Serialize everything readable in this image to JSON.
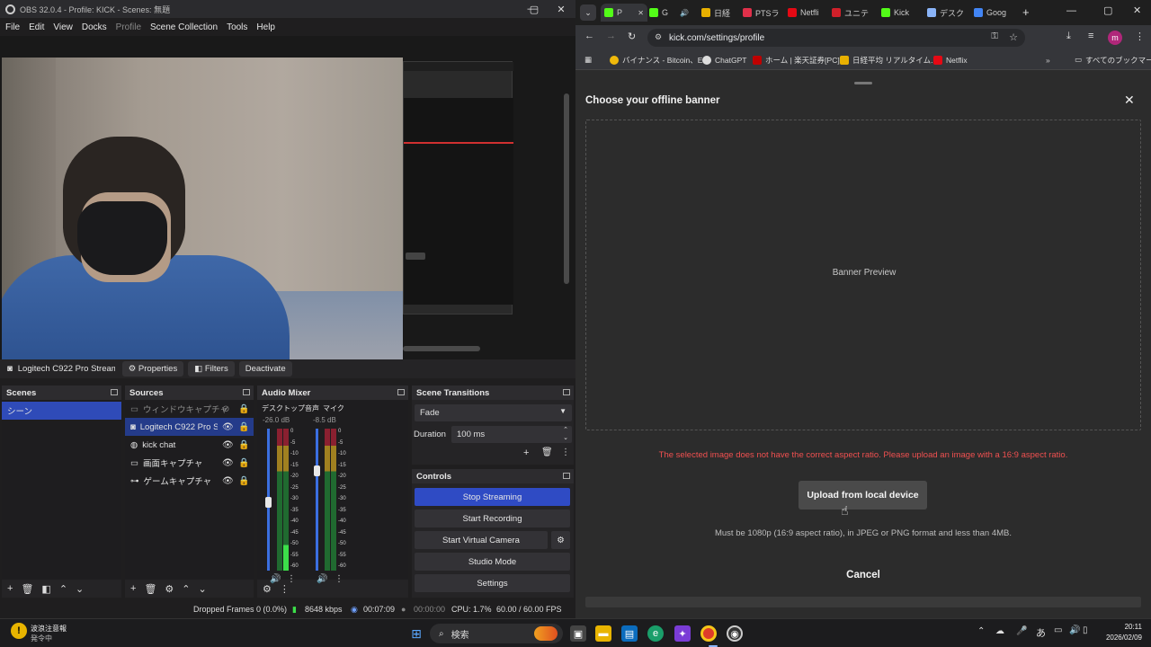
{
  "obs": {
    "title": "OBS 32.0.4 - Profile: KICK - Scenes: 無題",
    "menu": [
      "File",
      "Edit",
      "View",
      "Docks",
      "Profile",
      "Scene Collection",
      "Tools",
      "Help"
    ],
    "source_toolbar": {
      "source_name": "Logitech C922 Pro Stream W",
      "properties": "Properties",
      "filters": "Filters",
      "deactivate": "Deactivate"
    },
    "docks": {
      "scenes": {
        "title": "Scenes",
        "items": [
          "シーン"
        ]
      },
      "sources": {
        "title": "Sources",
        "items": [
          "ウィンドウキャプチャ",
          "Logitech C922 Pro Stre",
          "kick chat",
          "画面キャプチャ",
          "ゲームキャプチャ"
        ]
      },
      "audio_mixer": {
        "title": "Audio Mixer",
        "channels": [
          {
            "name": "デスクトップ音声",
            "db": "-26.0 dB"
          },
          {
            "name": "マイク",
            "db": "-8.5 dB"
          }
        ],
        "scale": [
          "0",
          "-5",
          "-10",
          "-15",
          "-20",
          "-25",
          "-30",
          "-35",
          "-40",
          "-45",
          "-50",
          "-55",
          "-60"
        ]
      },
      "scene_transitions": {
        "title": "Scene Transitions",
        "transition": "Fade",
        "duration_label": "Duration",
        "duration_value": "100 ms"
      },
      "controls": {
        "title": "Controls",
        "buttons": [
          "Stop Streaming",
          "Start Recording",
          "Start Virtual Camera",
          "Studio Mode",
          "Settings"
        ]
      }
    },
    "status": {
      "dropped_frames": "Dropped Frames 0 (0.0%)",
      "bitrate": "8648 kbps",
      "stream_time": "00:07:09",
      "rec_time": "00:00:00",
      "cpu": "CPU: 1.7%",
      "fps": "60.00 / 60.00 FPS"
    }
  },
  "chrome": {
    "tabs": [
      {
        "label": "P",
        "color": "#53fc18"
      },
      {
        "label": "G",
        "color": "#53fc18"
      },
      {
        "label": "日経",
        "color": "#e8b000"
      },
      {
        "label": "PTSラ",
        "color": "#e0304a"
      },
      {
        "label": "Netfli",
        "color": "#e50914"
      },
      {
        "label": "ユニテ",
        "color": "#d0202a"
      },
      {
        "label": "Kick",
        "color": "#53fc18"
      },
      {
        "label": "デスク",
        "color": "#8ab4f8"
      },
      {
        "label": "Goog",
        "color": "#4285f4"
      }
    ],
    "url": "kick.com/settings/profile",
    "bookmarks": [
      "バイナンス - Bitcoin、E...",
      "ChatGPT",
      "ホーム | 楽天証券[PC]",
      "日経平均 リアルタイム...",
      "Netflix",
      "すべてのブックマーク"
    ],
    "profile_initial": "m",
    "modal": {
      "title": "Choose your offline banner",
      "preview_label": "Banner Preview",
      "error": "The selected image does not have the correct aspect ratio. Please upload an image with a 16:9 aspect ratio.",
      "upload_button": "Upload from local device",
      "hint": "Must be 1080p (16:9 aspect ratio), in JPEG or PNG format and less than 4MB.",
      "cancel": "Cancel"
    }
  },
  "taskbar": {
    "weather_title": "波浪注意報",
    "weather_sub": "発令中",
    "search": "検索",
    "ime": "あ",
    "time": "20:11",
    "date": "2026/02/09"
  }
}
